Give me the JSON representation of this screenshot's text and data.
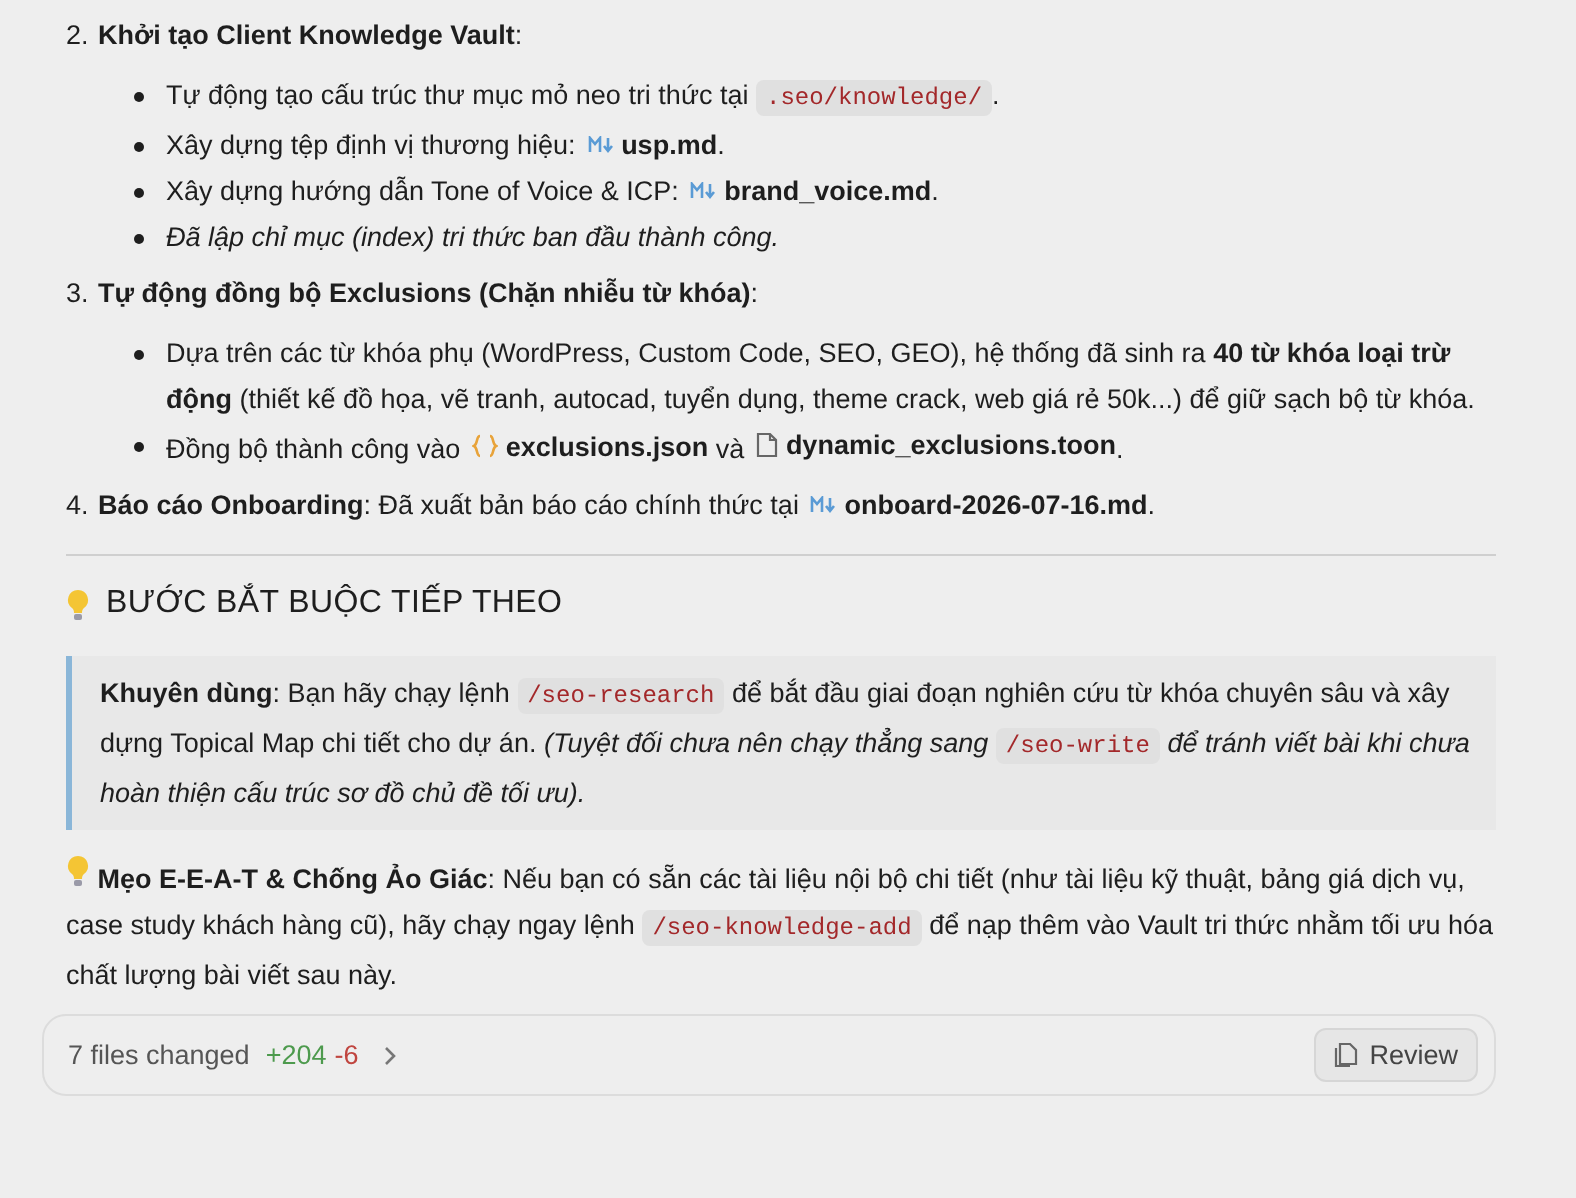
{
  "steps": [
    {
      "number": "2.",
      "title": [
        {
          "kind": "text",
          "text": "**Khởi tạo Client Knowledge Vault**:"
        }
      ],
      "bullets": [
        {
          "italic": false,
          "segments": [
            {
              "kind": "text",
              "text": "Tự động tạo cấu trúc thư mục mỏ neo tri thức tại "
            },
            {
              "kind": "code",
              "text": ".seo/knowledge/"
            },
            {
              "kind": "text",
              "text": "."
            }
          ]
        },
        {
          "italic": false,
          "segments": [
            {
              "kind": "text",
              "text": "Xây dựng tệp định vị thương hiệu: "
            },
            {
              "kind": "file_md",
              "text": "usp.md"
            },
            {
              "kind": "text",
              "text": "."
            }
          ]
        },
        {
          "italic": false,
          "segments": [
            {
              "kind": "text",
              "text": "Xây dựng hướng dẫn Tone of Voice & ICP: "
            },
            {
              "kind": "file_md",
              "text": "brand_voice.md"
            },
            {
              "kind": "text",
              "text": "."
            }
          ]
        },
        {
          "italic": true,
          "segments": [
            {
              "kind": "text",
              "text": "Đã lập chỉ mục (index) tri thức ban đầu thành công."
            }
          ]
        }
      ]
    },
    {
      "number": "3.",
      "title": [
        {
          "kind": "text",
          "text": "**Tự động đồng bộ Exclusions (Chặn nhiễu từ khóa)**:"
        }
      ],
      "bullets": [
        {
          "italic": false,
          "segments": [
            {
              "kind": "text",
              "text": "Dựa trên các từ khóa phụ (WordPress, Custom Code, SEO, GEO), hệ thống đã sinh ra **40 từ khóa loại trừ động** (thiết kế đồ họa, vẽ tranh, autocad, tuyển dụng, theme crack, web giá rẻ 50k...) để giữ sạch bộ từ khóa."
            }
          ]
        },
        {
          "italic": false,
          "segments": [
            {
              "kind": "text",
              "text": "Đồng bộ thành công vào "
            },
            {
              "kind": "file_json",
              "text": "exclusions.json"
            },
            {
              "kind": "text",
              "text": " và "
            },
            {
              "kind": "file_doc",
              "text": "dynamic_exclusions.toon"
            },
            {
              "kind": "text",
              "text": "."
            }
          ]
        }
      ]
    },
    {
      "number": "4.",
      "title": [
        {
          "kind": "text",
          "text": "**Báo cáo Onboarding**: Đã xuất bản báo cáo chính thức tại "
        },
        {
          "kind": "file_md",
          "text": "onboard-2026-07-16.md"
        },
        {
          "kind": "text",
          "text": "."
        }
      ]
    }
  ],
  "heading": "BƯỚC BẮT BUỘC TIẾP THEO",
  "callout": [
    {
      "kind": "text",
      "text": "**Khuyên dùng**: Bạn hãy chạy lệnh "
    },
    {
      "kind": "code",
      "text": "/seo-research"
    },
    {
      "kind": "text",
      "text": " để bắt đầu giai đoạn nghiên cứu từ khóa chuyên sâu và xây dựng Topical Map chi tiết cho dự án. *(Tuyệt đối chưa nên chạy thẳng sang* "
    },
    {
      "kind": "code",
      "text": "/seo-write"
    },
    {
      "kind": "text",
      "text": " *để tránh viết bài khi chưa hoàn thiện cấu trúc sơ đồ chủ đề tối ưu).*"
    }
  ],
  "tip": [
    {
      "kind": "text",
      "text": "**Mẹo E-E-A-T & Chống Ảo Giác**: Nếu bạn có sẵn các tài liệu nội bộ chi tiết (như tài liệu kỹ thuật, bảng giá dịch vụ, case study khách hàng cũ), hãy chạy ngay lệnh "
    },
    {
      "kind": "code",
      "text": "/seo-knowledge-add"
    },
    {
      "kind": "text",
      "text": " để nạp thêm vào Vault tri thức nhằm tối ưu hóa chất lượng bài viết sau này."
    }
  ],
  "changes": {
    "summary": "7 files changed",
    "added": "+204",
    "removed": "-6",
    "button": "Review"
  }
}
